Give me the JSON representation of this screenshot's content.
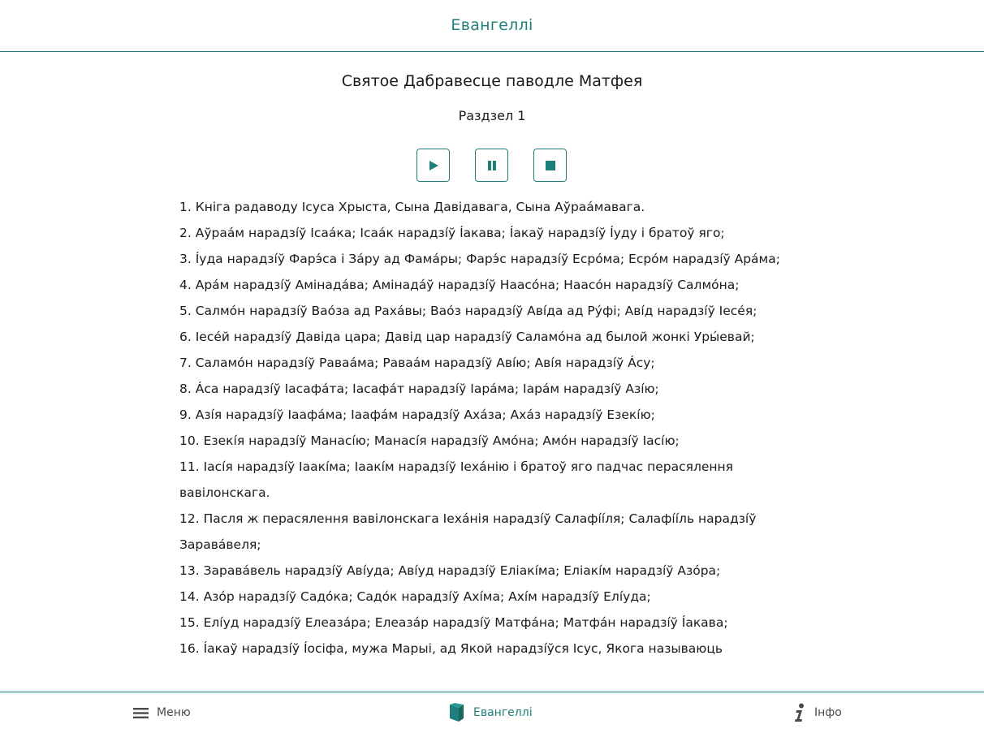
{
  "header": {
    "title": "Евангеллі"
  },
  "book": {
    "title": "Святое Дабравесце паводле Матфея",
    "chapter": "Раздзел 1"
  },
  "controls": {
    "play_icon": "play-icon",
    "pause_icon": "pause-icon",
    "stop_icon": "stop-icon"
  },
  "verses": [
    "1. Кніга радаводу Ісуса Хрыста, Сына Давідавага, Сына Аўраáмавага.",
    "2. Аўраáм нарадзíў Ісаáка; Ісаáк нарадзíў Íакава; Íакаў нарадзíў Íуду і братоў яго;",
    "3. Íуда нарадзíў Фарэ́са і Зáру ад Фамáры; Фарэ́с нарадзíў Есрóма; Есрóм нарадзíў Арáма;",
    "4. Арáм нарадзíў Амінадáва; Амінадáў нарадзíў Наасóна; Наасóн нарадзíў Салмóна;",
    "5. Салмóн нарадзíў Ваóза ад Рахáвы; Ваóз нарадзíў Авíда ад Рýфі; Авíд нарадзíў Іесéя;",
    "6. Іесéй нарадзíў Давіда цара; Давід цар нарадзíў Саламóна ад былой жонкі Уры́евай;",
    "7. Саламóн нарадзíў Раваáма; Раваáм нарадзíў Авíю; Авíя нарадзíў Áсу;",
    "8. Áса нарадзíў Іасафáта; Іасафáт нарадзíў Іарáма; Іарáм нарадзíў Азíю;",
    "9. Азíя нарадзíў Іаафáма; Іаафáм нарадзíў Ахáза; Ахáз нарадзíў Езекíю;",
    "10. Езекíя нарадзíў Манасíю; Манасíя нарадзíў Амóна; Амóн нарадзíў Іасíю;",
    "11. Іасíя нарадзíў Іаакíма; Іаакíм нарадзíў Іехáнію і братоў яго падчас перасялення вавілонскага.",
    "12. Пасля ж перасялення вавілонскага Іехáнія нарадзíў Салафííля; Салафííль нарадзíў Заравáвеля;",
    "13. Заравáвель нарадзíў Авíуда; Авíуд нарадзíў Еліакíма; Еліакíм нарадзíў Азóра;",
    "14. Азóр нарадзíў Садóка; Садóк нарадзíў Ахíма; Ахíм нарадзíў Елíуда;",
    "15. Елíуд нарадзíў Елеазáра; Елеазáр нарадзíў Матфáна; Матфáн нарадзíў Íакава;",
    "16. Íакаў нарадзíў Íосіфа, мужа Марыі, ад Якой нарадзíўся Ісус, Якога называюць"
  ],
  "bottom_nav": {
    "menu_label": "Меню",
    "gospel_label": "Евангеллі",
    "info_label": "Інфо"
  },
  "colors": {
    "accent": "#1e7f7a",
    "text": "#1a1a1a"
  }
}
